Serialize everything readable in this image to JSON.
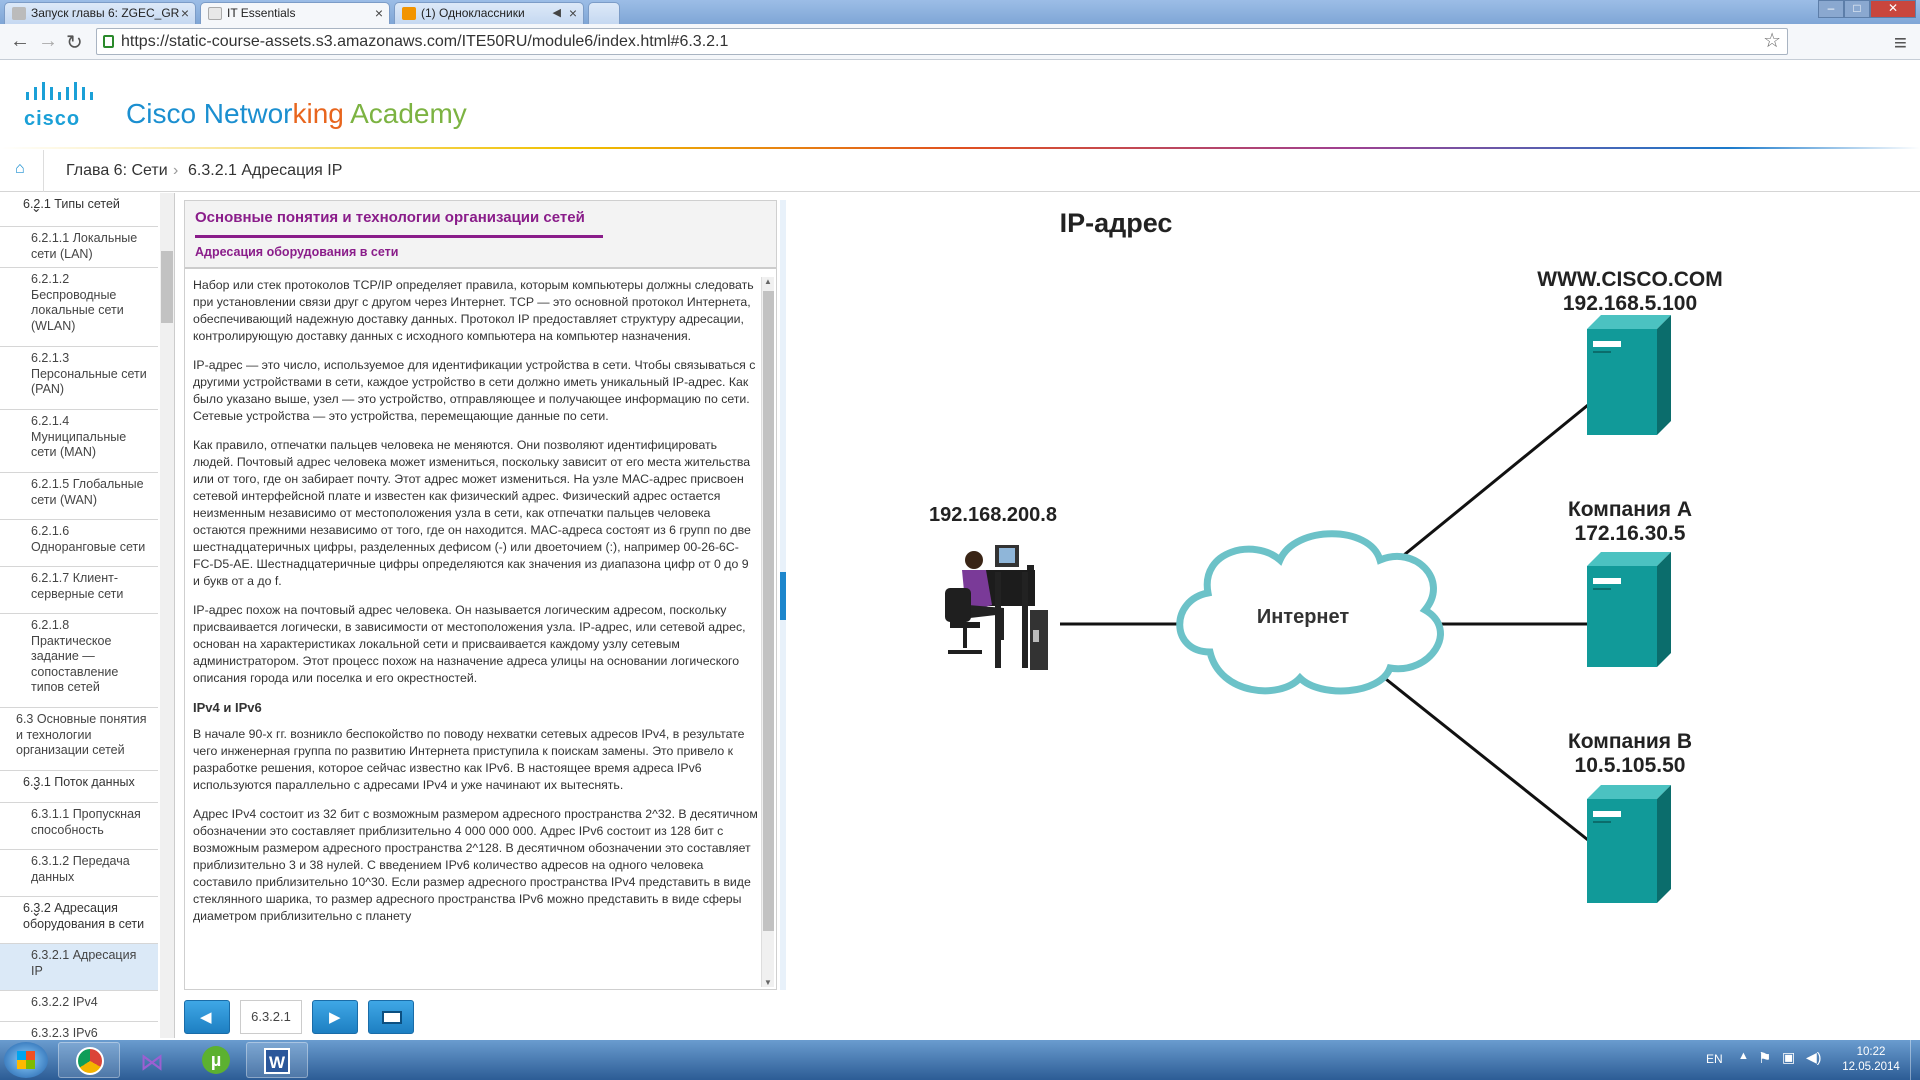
{
  "browser": {
    "tabs": [
      {
        "label": "Запуск главы 6: ZGEC_GR"
      },
      {
        "label": "IT Essentials"
      },
      {
        "label": "(1) Одноклассники"
      }
    ],
    "url": "https://static-course-assets.s3.amazonaws.com/ITE50RU/module6/index.html#6.3.2.1"
  },
  "header": {
    "cisco_word": "CISCO",
    "academy_title_prefix": "Cisco Networ",
    "academy_title_king": "king",
    "academy_title_suffix": " Academy"
  },
  "breadcrumb": {
    "chapter": "Глава 6: Сети",
    "sep": "›",
    "current": "6.3.2.1 Адресация IP"
  },
  "sidebar": {
    "items": [
      {
        "label": "6.2.1 Типы сетей"
      },
      {
        "label": "6.2.1.1 Локальные сети (LAN)"
      },
      {
        "label": "6.2.1.2 Беспроводные локальные сети (WLAN)"
      },
      {
        "label": "6.2.1.3 Персональные сети (PAN)"
      },
      {
        "label": "6.2.1.4 Муниципальные сети (MAN)"
      },
      {
        "label": "6.2.1.5 Глобальные сети (WAN)"
      },
      {
        "label": "6.2.1.6 Одноранговые сети"
      },
      {
        "label": "6.2.1.7 Клиент-серверные сети"
      },
      {
        "label": "6.2.1.8 Практическое задание — сопоставление типов сетей"
      },
      {
        "label": "6.3 Основные понятия и технологии организации сетей"
      },
      {
        "label": "6.3.1 Поток данных"
      },
      {
        "label": "6.3.1.1 Пропускная способность"
      },
      {
        "label": "6.3.1.2 Передача данных"
      },
      {
        "label": "6.3.2 Адресация оборудования в сети"
      },
      {
        "label": "6.3.2.1 Адресация IP"
      },
      {
        "label": "6.3.2.2 IPv4"
      },
      {
        "label": "6.3.2.3 IPv6"
      }
    ]
  },
  "content": {
    "section_title": "Основные понятия и технологии организации сетей",
    "subtitle": "Адресация оборудования в сети",
    "paragraphs": [
      "Набор или стек протоколов TCP/IP определяет правила, которым компьютеры должны следовать при установлении связи друг с другом через Интернет. TCP — это основной протокол Интернета, обеспечивающий надежную доставку данных. Протокол IP предоставляет структуру адресации, контролирующую доставку данных с исходного компьютера на компьютер назначения.",
      "IP-адрес — это число, используемое для идентификации устройства в сети. Чтобы связываться с другими устройствами в сети, каждое устройство в сети должно иметь уникальный IP-адрес. Как было указано выше, узел — это устройство, отправляющее и получающее информацию по сети. Сетевые устройства — это устройства, перемещающие данные по сети.",
      "Как правило, отпечатки пальцев человека не меняются. Они позволяют идентифицировать людей. Почтовый адрес человека может измениться, поскольку зависит от его места жительства или от того, где он забирает почту. Этот адрес может измениться. На узле MAC-адрес присвоен сетевой интерфейсной плате и известен как физический адрес. Физический адрес остается неизменным независимо от местоположения узла в сети, как отпечатки пальцев человека остаются прежними независимо от того, где он находится. MAC-адреса состоят из 6 групп по две шестнадцатеричных цифры, разделенных дефисом (-) или двоеточием (:), например 00-26-6C-FC-D5-AE. Шестнадцатеричные цифры определяются как значения из диапазона цифр от 0 до 9 и букв от a до f.",
      "IP-адрес похож на почтовый адрес человека. Он называется логическим адресом, поскольку присваивается логически, в зависимости от местоположения узла. IP-адрес, или сетевой адрес, основан на характеристиках локальной сети и присваивается каждому узлу сетевым администратором. Этот процесс похож на назначение адреса улицы на основании логического описания города или поселка и его окрестностей."
    ],
    "heading2": "IPv4 и IPv6",
    "paragraphs2": [
      "В начале 90-х гг. возникло беспокойство по поводу нехватки сетевых адресов IPv4, в результате чего инженерная группа по развитию Интернета приступила к поискам замены. Это привело к разработке решения, которое сейчас известно как IPv6. В настоящее время адреса IPv6 используются параллельно с адресами IPv4 и уже начинают их вытеснять.",
      "Адрес IPv4 состоит из 32 бит с возможным размером адресного пространства 2^32. В десятичном обозначении это составляет приблизительно 4 000 000 000. Адрес IPv6 состоит из 128 бит с возможным размером адресного пространства 2^128. В десятичном обозначении это составляет приблизительно 3 и 38 нулей. С введением IPv6 количество адресов на одного человека составило приблизительно 10^30. Если размер адресного пространства IPv4 представить в виде стеклянного шарика, то размер адресного пространства IPv6 можно представить в виде сферы диаметром приблизительно с планету"
    ]
  },
  "nav": {
    "page_number": "6.3.2.1"
  },
  "diagram": {
    "title": "IP-адрес",
    "pc_ip": "192.168.200.8",
    "cloud_label": "Интернет",
    "servers": [
      {
        "name": "WWW.CISCO.COM",
        "ip": "192.168.5.100"
      },
      {
        "name": "Компания А",
        "ip": "172.16.30.5"
      },
      {
        "name": "Компания В",
        "ip": "10.5.105.50"
      }
    ]
  },
  "taskbar": {
    "lang": "EN",
    "time": "10:22",
    "date": "12.05.2014"
  },
  "colors": {
    "accent_purple": "#8a1d8a",
    "server_teal": "#119a99",
    "nav_blue": "#1d86cc"
  }
}
